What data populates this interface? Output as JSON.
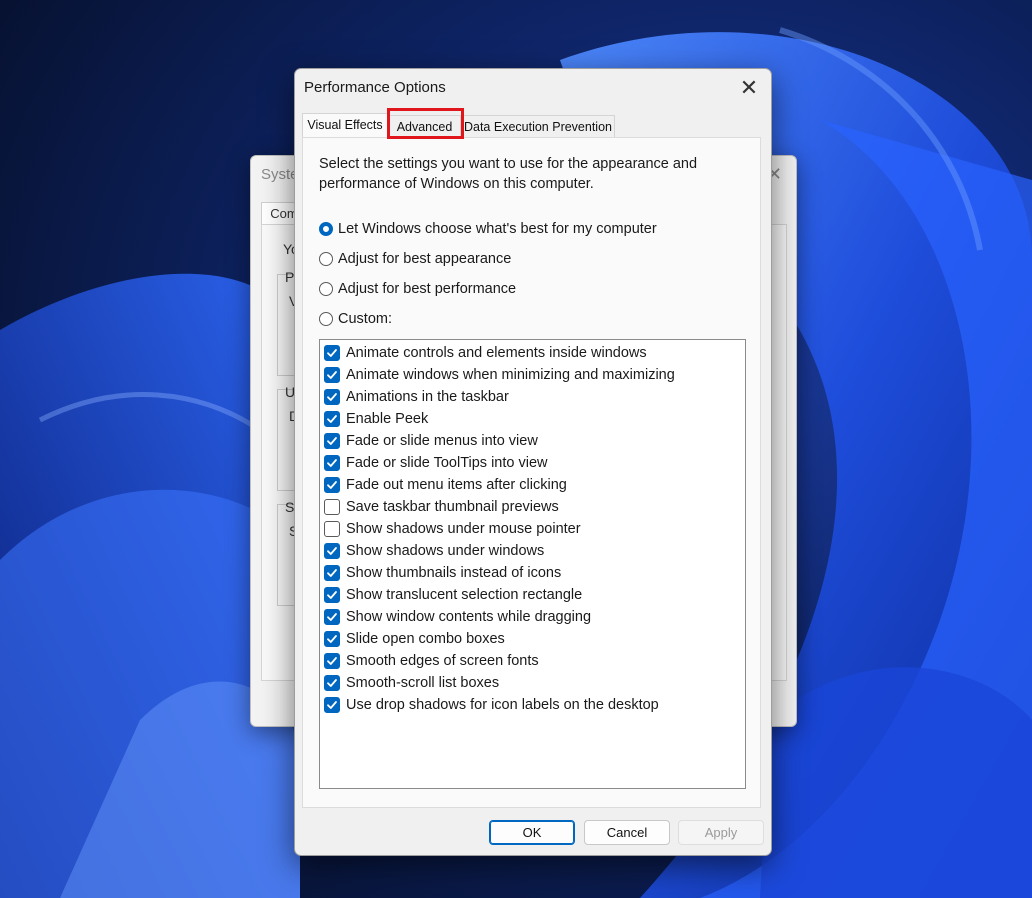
{
  "background_window": {
    "title": "Syste",
    "close_glyph": "✕",
    "tab": "Com",
    "fragments": [
      "Yo",
      "P",
      "V",
      "U",
      "D",
      "S",
      "S"
    ]
  },
  "dialog": {
    "title": "Performance Options",
    "close_glyph": "✕",
    "tabs": [
      {
        "label": "Visual Effects",
        "active": true
      },
      {
        "label": "Advanced",
        "active": false,
        "highlighted": true
      },
      {
        "label": "Data Execution Prevention",
        "active": false
      }
    ],
    "intro": "Select the settings you want to use for the appearance and performance of Windows on this computer.",
    "radio_options": [
      {
        "label": "Let Windows choose what's best for my computer",
        "selected": true
      },
      {
        "label": "Adjust for best appearance",
        "selected": false
      },
      {
        "label": "Adjust for best performance",
        "selected": false
      },
      {
        "label": "Custom:",
        "selected": false
      }
    ],
    "effects": [
      {
        "label": "Animate controls and elements inside windows",
        "checked": true
      },
      {
        "label": "Animate windows when minimizing and maximizing",
        "checked": true
      },
      {
        "label": "Animations in the taskbar",
        "checked": true
      },
      {
        "label": "Enable Peek",
        "checked": true
      },
      {
        "label": "Fade or slide menus into view",
        "checked": true
      },
      {
        "label": "Fade or slide ToolTips into view",
        "checked": true
      },
      {
        "label": "Fade out menu items after clicking",
        "checked": true
      },
      {
        "label": "Save taskbar thumbnail previews",
        "checked": false
      },
      {
        "label": "Show shadows under mouse pointer",
        "checked": false
      },
      {
        "label": "Show shadows under windows",
        "checked": true
      },
      {
        "label": "Show thumbnails instead of icons",
        "checked": true
      },
      {
        "label": "Show translucent selection rectangle",
        "checked": true
      },
      {
        "label": "Show window contents while dragging",
        "checked": true
      },
      {
        "label": "Slide open combo boxes",
        "checked": true
      },
      {
        "label": "Smooth edges of screen fonts",
        "checked": true
      },
      {
        "label": "Smooth-scroll list boxes",
        "checked": true
      },
      {
        "label": "Use drop shadows for icon labels on the desktop",
        "checked": true
      }
    ],
    "buttons": {
      "ok": "OK",
      "cancel": "Cancel",
      "apply": "Apply"
    }
  },
  "colors": {
    "accent": "#0067c0",
    "highlight_box": "#e0161c"
  }
}
